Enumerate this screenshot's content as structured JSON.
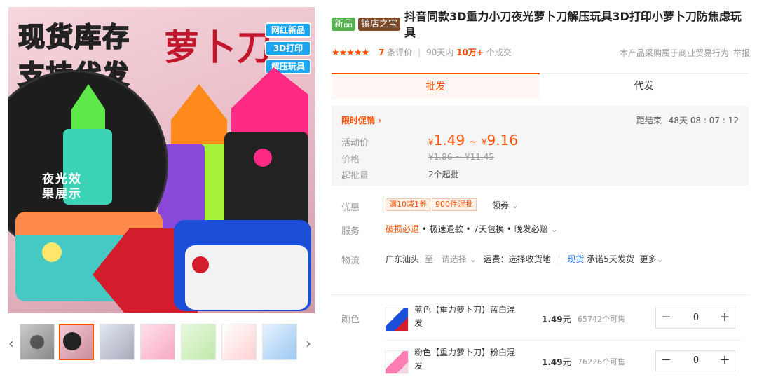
{
  "gallery": {
    "headline_line1": "现货库存",
    "headline_line2": "支持代发",
    "brand": "萝卜刀",
    "tags": [
      "网红新品",
      "3D打印",
      "解压玩具"
    ],
    "glow_text": "夜光效果展示",
    "colors": {
      "orange": "#ff8a1c",
      "pink": "#ff2a84",
      "green": "#5ee84a",
      "purple": "#8a49d8",
      "blue": "#1c4fd8",
      "red": "#d31c2c",
      "teal": "#3bd3b5",
      "black": "#222222",
      "white": "#f2f2f2"
    },
    "prev_icon": "chevron-left-icon",
    "next_icon": "chevron-right-icon",
    "thumbnail_count": 7,
    "active_thumbnail": 2
  },
  "product": {
    "badge_new": "新品",
    "badge_shop": "镇店之宝",
    "title": "抖音同款3D重力小刀夜光萝卜刀解压玩具3D打印小萝卜刀防焦虑玩具",
    "stars_icon": "star-icon",
    "rating_count": "7",
    "rating_suffix": "条评价",
    "sales_prefix": "90天内",
    "sales_value": "10万+",
    "sales_suffix": "个成交",
    "trade_note": "本产品采购属于商业贸易行为",
    "report": "举报"
  },
  "tabs": {
    "wholesale": "批发",
    "dropship": "代发"
  },
  "price": {
    "promo_label": "限时促销",
    "countdown_label": "距结束",
    "countdown_value": "48天 08 : 07 : 12",
    "activity_label": "活动价",
    "currency": "¥",
    "low": "1.49",
    "high": "9.16",
    "tilde": "~",
    "price_label": "价格",
    "old_price": "¥1.86 ~ ¥11.45",
    "moq_label": "起批量",
    "moq_value": "2个起批"
  },
  "offers": {
    "label": "优惠",
    "coupon1": "满10减1券",
    "coupon2": "900件混批",
    "get_coupon": "领券"
  },
  "service": {
    "label": "服务",
    "damage": "破损必退",
    "rest": "• 极速退款 • 7天包换 • 晚发必赔"
  },
  "logistics": {
    "label": "物流",
    "from": "广东汕头",
    "to_word": "至",
    "select_placeholder": "请选择",
    "freight": "运费：选择收货地",
    "stock_badge": "现货",
    "promise": "承诺5天发货",
    "more": "更多"
  },
  "sku": {
    "label": "颜色",
    "items": [
      {
        "name": "蓝色【重力萝卜刀】蓝白混发",
        "price": "1.49",
        "unit": "元",
        "stock": "65742个可售",
        "qty": "0"
      },
      {
        "name": "粉色【重力萝卜刀】粉白混发",
        "price": "1.49",
        "unit": "元",
        "stock": "76226个可售",
        "qty": "0"
      }
    ],
    "minus": "−",
    "plus": "+"
  }
}
